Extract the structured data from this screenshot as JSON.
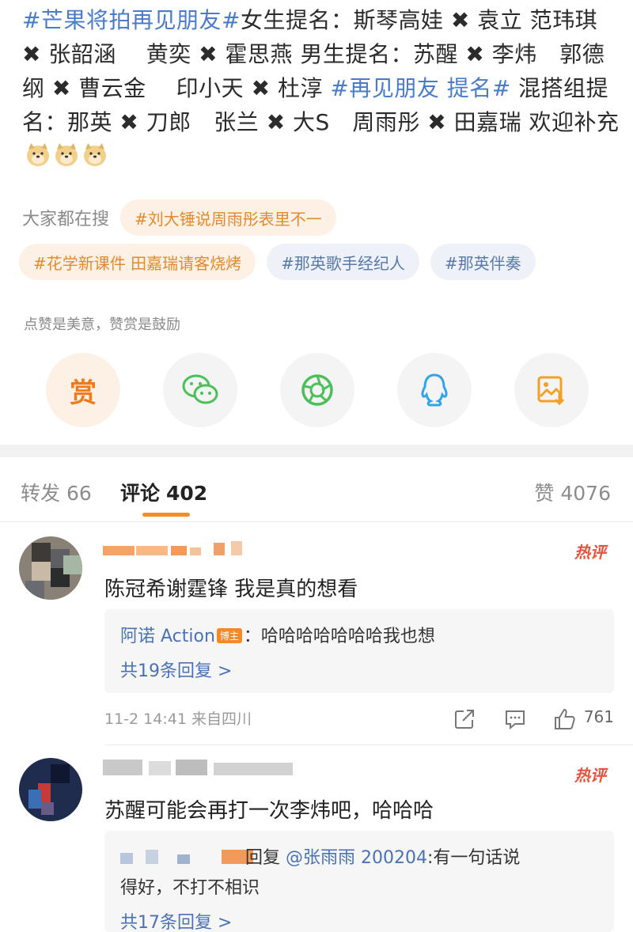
{
  "post": {
    "tag1": "#芒果将拍再见朋友#",
    "text1": "女生提名：斯琴高娃 ",
    "x": "✖",
    "text2": " 袁立 范玮琪 ",
    "text3": " 张韶涵　 黄奕 ",
    "text4": " 霍思燕 男生提名：苏醒 ",
    "text5": " 李炜　郭德纲 ",
    "text6": " 曹云金　 印小天 ",
    "text7": " 杜淳 ",
    "tag2": "#再见朋友 提名#",
    "text8": " 混搭组提名：那英 ",
    "text9": " 刀郎　张兰 ",
    "text10": " 大S　周雨彤 ",
    "text11": " 田嘉瑞 欢迎补充",
    "emoji": "doge-emoji"
  },
  "hot_search": {
    "label": "大家都在搜",
    "items": [
      "#刘大锤说周雨彤表里不一",
      "#花学新课件 田嘉瑞请客烧烤",
      "#那英歌手经纪人",
      "#那英伴奏"
    ]
  },
  "reward": {
    "hint": "点赞是美意，赞赏是鼓励",
    "button": "赏",
    "share_icons": [
      "reward-icon",
      "wechat-icon",
      "moments-icon",
      "qq-icon",
      "save-image-icon"
    ]
  },
  "tabs": {
    "repost_label": "转发",
    "repost_count": "66",
    "comment_label": "评论",
    "comment_count": "402",
    "like_label": "赞",
    "like_count": "4076"
  },
  "comments": [
    {
      "hot": "热评",
      "text": "陈冠希谢霆锋 我是真的想看",
      "reply_author": "阿诺 Action",
      "reply_badge": "博主",
      "reply_text": "：哈哈哈哈哈哈哈我也想",
      "reply_more": "共19条回复 >",
      "time": "11-2 14:41 来自四川",
      "likes": "761"
    },
    {
      "hot": "热评",
      "text": "苏醒可能会再打一次李炜吧，哈哈哈",
      "reply_prefix": "回复",
      "reply_mention": "@张雨雨 200204",
      "reply_text_1": ":有一句话说",
      "reply_text_2": "得好，不打不相识",
      "reply_more": "共17条回复 >"
    }
  ],
  "colors": {
    "accent_orange": "#f08f2a",
    "link_blue": "#4a72b5",
    "hot_red": "#e5533e"
  }
}
